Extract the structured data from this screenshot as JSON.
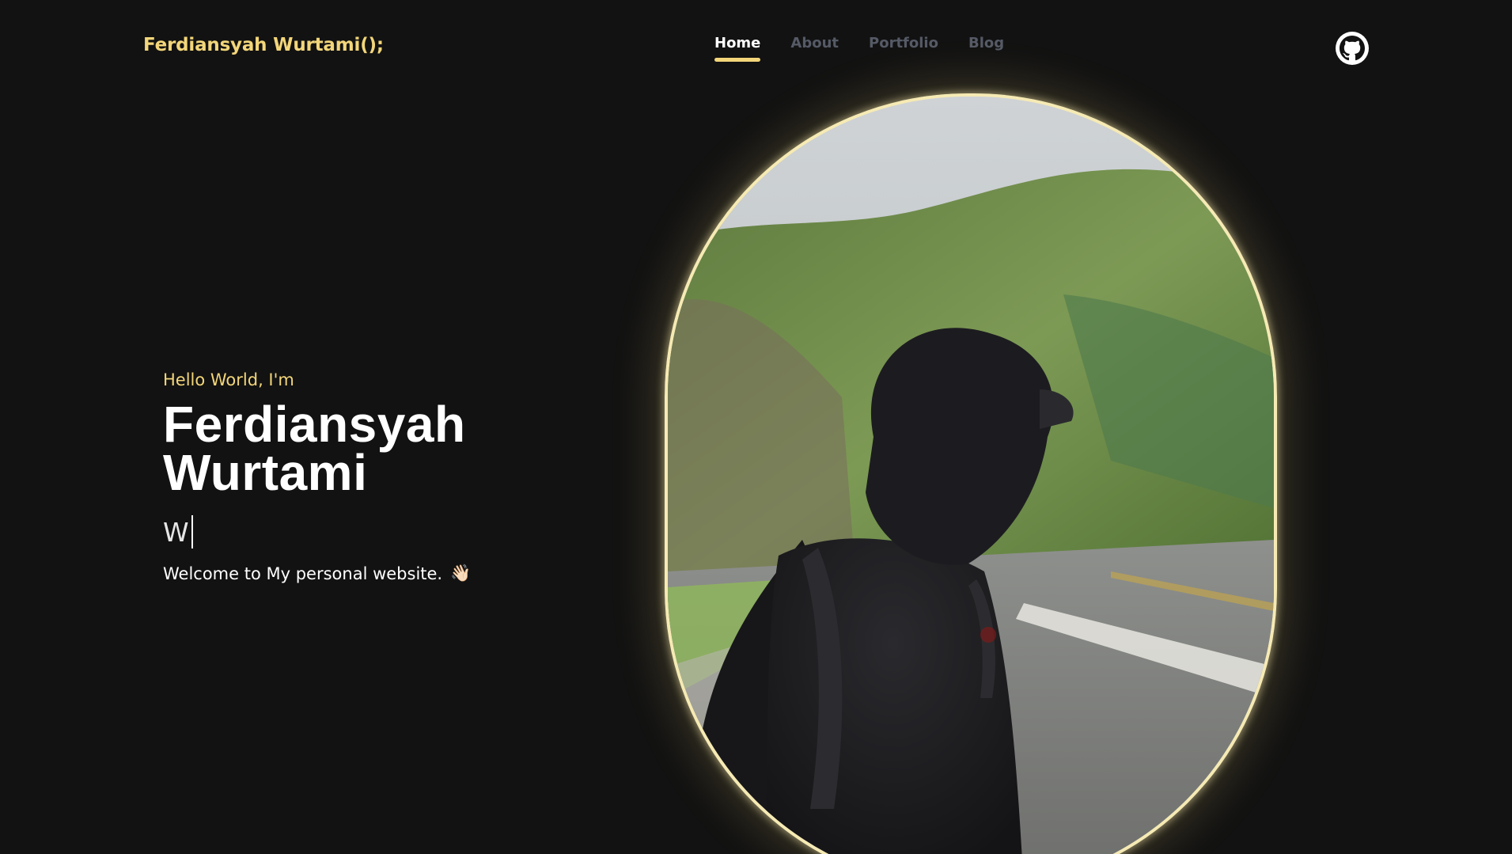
{
  "header": {
    "brand": "Ferdiansyah Wurtami();",
    "nav": [
      {
        "label": "Home",
        "active": true
      },
      {
        "label": "About",
        "active": false
      },
      {
        "label": "Portfolio",
        "active": false
      },
      {
        "label": "Blog",
        "active": false
      }
    ],
    "github_icon": "github-icon"
  },
  "hero": {
    "greeting": "Hello World, I'm",
    "name_line1": "Ferdiansyah",
    "name_line2": "Wurtami",
    "typed_text": "W",
    "welcome": "Welcome to My personal website.",
    "welcome_emoji": "👋🏻"
  },
  "colors": {
    "background": "#121212",
    "accent": "#f3d67a",
    "nav_inactive": "#555a66",
    "text": "#ffffff"
  }
}
